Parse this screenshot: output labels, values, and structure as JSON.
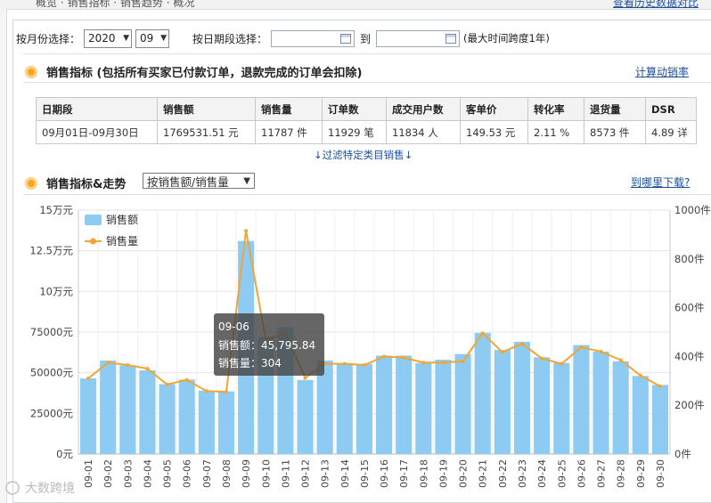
{
  "topbar": {
    "title": "概览 · 销售指标 · 销售趋势 · 概况",
    "link": "查看历史数据对比"
  },
  "filter": {
    "month_label": "按月份选择：",
    "year": "2020",
    "month": "09",
    "date_label": "按日期段选择：",
    "date_from": "",
    "to_label": "到",
    "date_to": "",
    "note": "(最大时间跨度1年)"
  },
  "kpi_section": {
    "title": "销售指标 (包括所有买家已付款订单，退款完成的订单会扣除)",
    "link": "计算动销率"
  },
  "kpi_table": {
    "headers": [
      "日期段",
      "销售额",
      "销售量",
      "订单数",
      "成交用户数",
      "客单价",
      "转化率",
      "退货量",
      "DSR"
    ],
    "row": [
      "09月01日-09月30日",
      "1769531.51  元",
      "11787  件",
      "11929  笔",
      "11834  人",
      "149.53  元",
      "2.11  %",
      "8573  件",
      "4.89  详"
    ]
  },
  "filter_link": "↓过滤特定类目销售↓",
  "trend_section": {
    "title": "销售指标&走势",
    "dropdown": "按销售额/销售量",
    "link": "到哪里下载?"
  },
  "colors": {
    "bar": "#8ecbf2",
    "line": "#f0a637",
    "accent": "#f5a623",
    "link": "#1a4f9c"
  },
  "chart_data": {
    "type": "bar",
    "categories": [
      "09-01",
      "09-02",
      "09-03",
      "09-04",
      "09-05",
      "09-06",
      "09-07",
      "09-08",
      "09-09",
      "09-10",
      "09-11",
      "09-12",
      "09-13",
      "09-14",
      "09-15",
      "09-16",
      "09-17",
      "09-18",
      "09-19",
      "09-20",
      "09-21",
      "09-22",
      "09-23",
      "09-24",
      "09-25",
      "09-26",
      "09-27",
      "09-28",
      "09-29",
      "09-30"
    ],
    "series": [
      {
        "name": "销售额",
        "type": "bar",
        "axis": "left",
        "values": [
          46500,
          57500,
          54500,
          51500,
          43000,
          45796,
          39000,
          38500,
          131000,
          72000,
          78000,
          45500,
          57500,
          56000,
          55500,
          60500,
          60500,
          56000,
          58000,
          61500,
          74500,
          64000,
          69000,
          59500,
          56000,
          67000,
          63000,
          57000,
          48000,
          42500
        ]
      },
      {
        "name": "销售量",
        "type": "line",
        "axis": "right",
        "values": [
          310,
          375,
          365,
          350,
          285,
          304,
          258,
          255,
          915,
          470,
          495,
          312,
          370,
          370,
          365,
          400,
          395,
          375,
          375,
          380,
          495,
          418,
          452,
          392,
          370,
          438,
          420,
          385,
          322,
          278
        ]
      }
    ],
    "left_axis": {
      "ticks": [
        "0元",
        "25000元",
        "50000元",
        "75000元",
        "10万元",
        "12.5万元",
        "15万元"
      ],
      "min": 0,
      "max": 150000
    },
    "right_axis": {
      "ticks": [
        "0件",
        "200件",
        "400件",
        "600件",
        "800件",
        "1000件"
      ],
      "min": 0,
      "max": 1000
    },
    "legend_position": "top-left",
    "tooltip": {
      "date": "09-06",
      "line1_label": "销售额：",
      "line1_value": "45,795.84",
      "line2_label": "销售量：",
      "line2_value": "304"
    }
  },
  "watermark": "大数跨境"
}
